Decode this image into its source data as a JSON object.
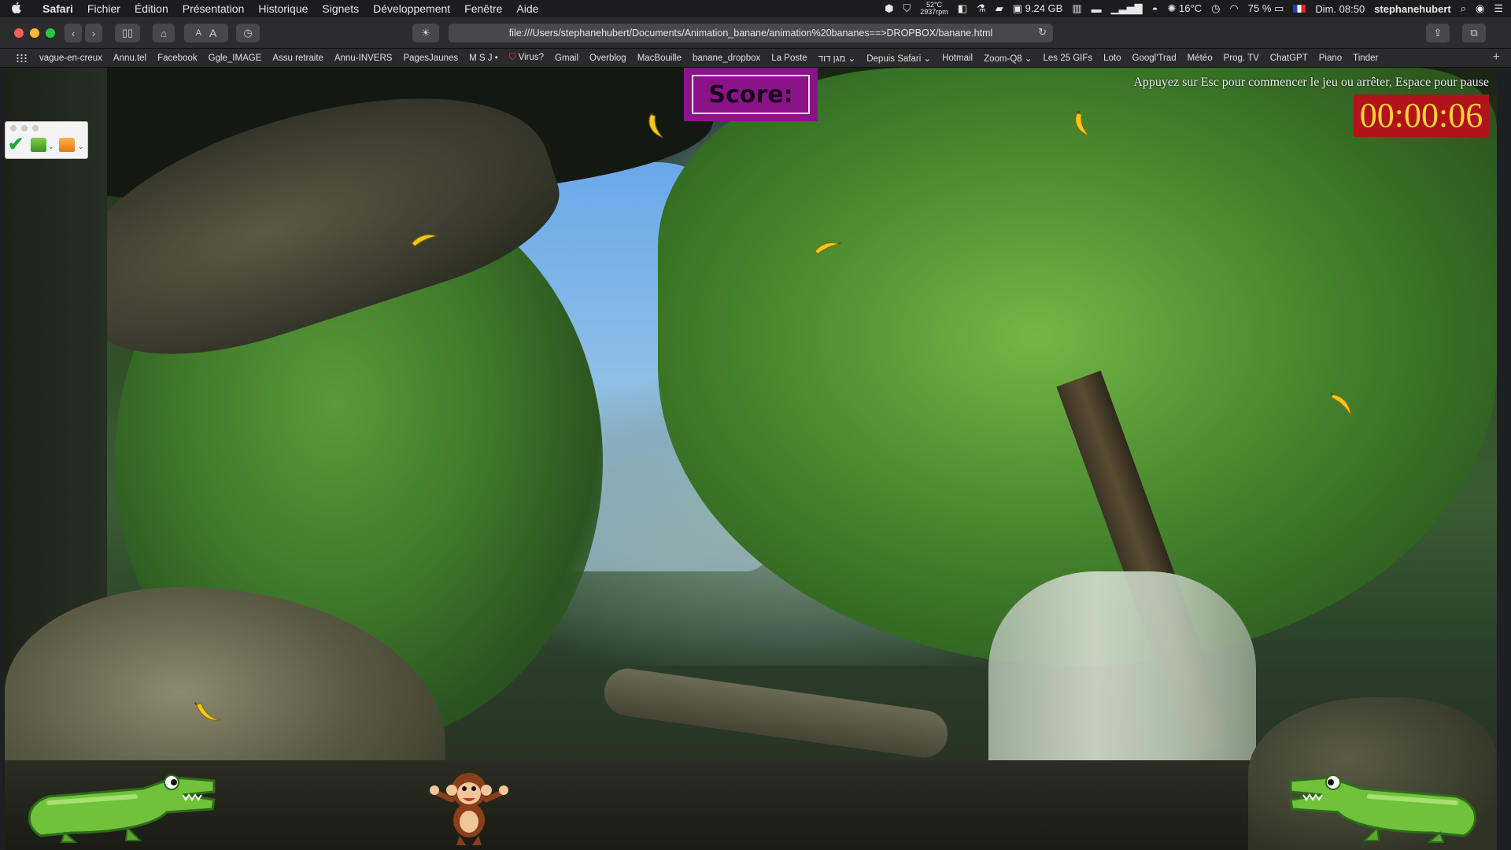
{
  "menubar": {
    "apple": "",
    "app_name": "Safari",
    "items": [
      "Fichier",
      "Édition",
      "Présentation",
      "Historique",
      "Signets",
      "Développement",
      "Fenêtre",
      "Aide"
    ],
    "status": {
      "cpu_temp": "52°C",
      "fan": "2937rpm",
      "memory": "9.24 GB",
      "weather": "16°C",
      "battery": "75 %",
      "datetime": "Dim. 08:50",
      "user": "stephanehubert"
    }
  },
  "toolbar": {
    "font_small": "A",
    "font_large": "A",
    "url": "file:///Users/stephanehubert/Documents/Animation_banane/animation%20bananes==>DROPBOX/banane.html",
    "reload": "↻"
  },
  "bookmarks": [
    "vague-en-creux",
    "Annu.tel",
    "Facebook",
    "Ggle_IMAGE",
    "Assu retraite",
    "Annu-INVERS",
    "PagesJaunes",
    "M S J •",
    "Virus?",
    "Gmail",
    "Overblog",
    "MacBouille",
    "banane_dropbox",
    "La Poste",
    "מגן דוד ⌄",
    "Depuis Safari ⌄",
    "Hotmail",
    "Zoom-Q8 ⌄",
    "Les 25 GIFs",
    "Loto",
    "Googl'Trad",
    "Météo",
    "Prog. TV",
    "ChatGPT",
    "Piano",
    "Tinder"
  ],
  "game": {
    "score_label": "Score:",
    "instructions": "Appuyez sur Esc pour commencer le jeu ou arrêter, Espace pour pause",
    "timer": "00:00:06",
    "colors": {
      "score_bg": "#8a138a",
      "timer_bg": "#b0141a",
      "timer_text": "#ffd23a"
    },
    "sprites": {
      "banana_icon": "banana-icon",
      "monkey_icon": "monkey-icon",
      "crocodile_icon": "crocodile-icon"
    }
  }
}
